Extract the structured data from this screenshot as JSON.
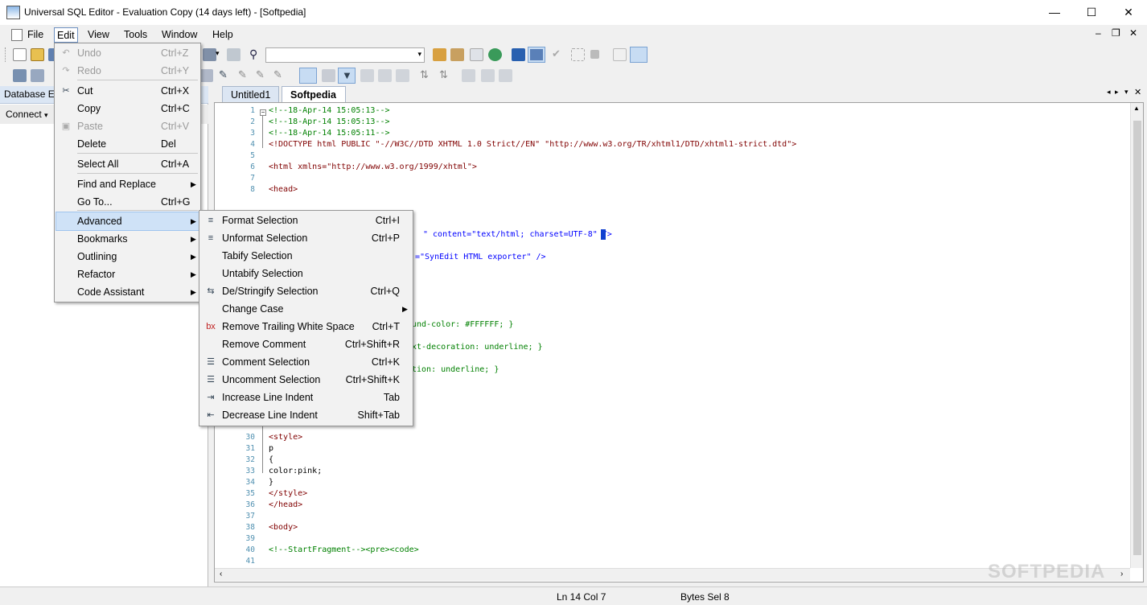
{
  "window": {
    "title": "Universal SQL Editor - Evaluation Copy (14 days left) - [Softpedia]",
    "minimize": "—",
    "maximize": "☐",
    "close": "✕"
  },
  "menubar": {
    "items": [
      "File",
      "Edit",
      "View",
      "Tools",
      "Window",
      "Help"
    ],
    "mdi_min": "‒",
    "mdi_restore": "❐",
    "mdi_close": "✕"
  },
  "left_panel": {
    "title": "Database E",
    "connect": "Connect",
    "connect_arrow": "▾"
  },
  "tabs": [
    "Untitled1",
    "Softpedia"
  ],
  "edit_menu": [
    {
      "label": "Undo",
      "shortcut": "Ctrl+Z",
      "disabled": true
    },
    {
      "label": "Redo",
      "shortcut": "Ctrl+Y",
      "disabled": true
    },
    {
      "label": "Cut",
      "shortcut": "Ctrl+X"
    },
    {
      "label": "Copy",
      "shortcut": "Ctrl+C"
    },
    {
      "label": "Paste",
      "shortcut": "Ctrl+V",
      "disabled": true
    },
    {
      "label": "Delete",
      "shortcut": "Del"
    },
    {
      "label": "Select All",
      "shortcut": "Ctrl+A"
    },
    {
      "label": "Find and Replace",
      "shortcut": ""
    },
    {
      "label": "Go To...",
      "shortcut": "Ctrl+G"
    },
    {
      "label": "Advanced",
      "shortcut": ""
    },
    {
      "label": "Bookmarks",
      "shortcut": ""
    },
    {
      "label": "Outlining",
      "shortcut": ""
    },
    {
      "label": "Refactor",
      "shortcut": ""
    },
    {
      "label": "Code Assistant",
      "shortcut": ""
    }
  ],
  "advanced_menu": [
    {
      "label": "Format Selection",
      "shortcut": "Ctrl+I"
    },
    {
      "label": "Unformat Selection",
      "shortcut": "Ctrl+P"
    },
    {
      "label": "Tabify Selection",
      "shortcut": ""
    },
    {
      "label": "Untabify Selection",
      "shortcut": ""
    },
    {
      "label": "De/Stringify Selection",
      "shortcut": "Ctrl+Q"
    },
    {
      "label": "Change Case",
      "shortcut": ""
    },
    {
      "label": "Remove Trailing White Space",
      "shortcut": "Ctrl+T"
    },
    {
      "label": "Remove Comment",
      "shortcut": "Ctrl+Shift+R"
    },
    {
      "label": "Comment Selection",
      "shortcut": "Ctrl+K"
    },
    {
      "label": "Uncomment Selection",
      "shortcut": "Ctrl+Shift+K"
    },
    {
      "label": "Increase Line Indent",
      "shortcut": "Tab"
    },
    {
      "label": "Decrease Line Indent",
      "shortcut": "Shift+Tab"
    }
  ],
  "code_lines": [
    {
      "n": "1",
      "t": "<!--18-Apr-14 15:05:13-->",
      "c": "com"
    },
    {
      "n": "2",
      "t": "<!--18-Apr-14 15:05:13-->",
      "c": "com"
    },
    {
      "n": "3",
      "t": "<!--18-Apr-14 15:05:11-->",
      "c": "com"
    },
    {
      "n": "4",
      "t": "<!DOCTYPE html PUBLIC \"-//W3C//DTD XHTML 1.0 Strict//EN\" \"http://www.w3.org/TR/xhtml1/DTD/xhtml1-strict.dtd\">",
      "c": "tag"
    },
    {
      "n": "5",
      "t": "",
      "c": "txt"
    },
    {
      "n": "6",
      "t": "<html xmlns=\"http://www.w3.org/1999/xhtml\">",
      "c": "tag"
    },
    {
      "n": "7",
      "t": "",
      "c": "txt"
    },
    {
      "n": "8",
      "t": "<head>",
      "c": "tag"
    },
    {
      "n": "30",
      "t": "<style>",
      "c": "tag"
    },
    {
      "n": "31",
      "t": "p",
      "c": "txt"
    },
    {
      "n": "32",
      "t": "{",
      "c": "txt"
    },
    {
      "n": "33",
      "t": "color:pink;",
      "c": "txt"
    },
    {
      "n": "34",
      "t": "}",
      "c": "txt"
    },
    {
      "n": "35",
      "t": "</style>",
      "c": "tag"
    },
    {
      "n": "36",
      "t": "</head>",
      "c": "tag"
    },
    {
      "n": "37",
      "t": "",
      "c": "txt"
    },
    {
      "n": "38",
      "t": "<body>",
      "c": "tag"
    },
    {
      "n": "39",
      "t": "",
      "c": "txt"
    },
    {
      "n": "40",
      "t": "<!--StartFragment--><pre><code>",
      "c": "com"
    },
    {
      "n": "41",
      "t": "",
      "c": "txt"
    }
  ],
  "visible_fragments": [
    "\" content=\"text/html; charset=UTF-8\" />",
    "=\"SynEdit HTML exporter\" />",
    "und-color: #FFFFFF; }",
    "xt-decoration: underline; }",
    "tion: underline; }"
  ],
  "status": {
    "position": "Ln 14  Col 7",
    "bytes": "Bytes Sel 8"
  },
  "watermark": "SOFTPEDIA"
}
